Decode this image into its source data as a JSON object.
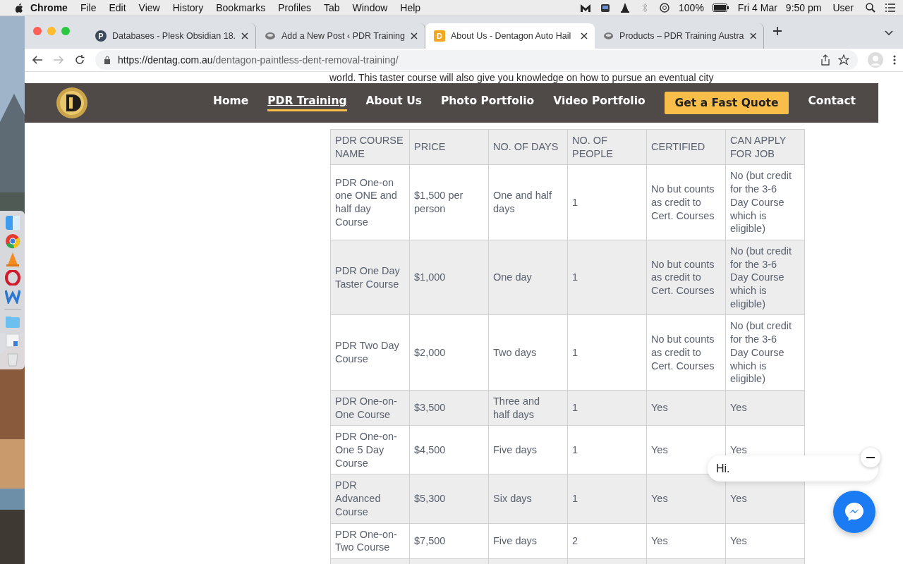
{
  "menu_bar": {
    "app": "Chrome",
    "items": [
      "File",
      "Edit",
      "View",
      "History",
      "Bookmarks",
      "Profiles",
      "Tab",
      "Window",
      "Help"
    ],
    "battery": "100%",
    "date": "Fri 4 Mar",
    "time": "9:50 pm",
    "user": "User"
  },
  "browser": {
    "tabs": [
      {
        "title": "Databases - Plesk Obsidian 18.",
        "kind": "letter",
        "icon_text": "P",
        "selected": false
      },
      {
        "title": "Add a New Post ‹ PDR Training",
        "kind": "site",
        "selected": false
      },
      {
        "title": "About Us - Dentagon Auto Hail",
        "kind": "brand",
        "icon_text": "D",
        "selected": true
      },
      {
        "title": "Products – PDR Training Austra",
        "kind": "site",
        "selected": false
      }
    ],
    "url_host": "https://dentag.com.au",
    "url_path": "/dentagon-paintless-dent-removal-training/"
  },
  "site": {
    "intro_fragment": "world. This taster course will also give you knowledge on how to pursue an eventual city",
    "nav": [
      {
        "label": "Home",
        "selected": false,
        "kind": "link"
      },
      {
        "label": "PDR Training",
        "selected": true,
        "kind": "link"
      },
      {
        "label": "About Us",
        "selected": false,
        "kind": "link"
      },
      {
        "label": "Photo Portfolio",
        "selected": false,
        "kind": "link"
      },
      {
        "label": "Video Portfolio",
        "selected": false,
        "kind": "link"
      },
      {
        "label": "Get a Fast Quote",
        "selected": false,
        "kind": "cta"
      },
      {
        "label": "Contact",
        "selected": false,
        "kind": "link"
      }
    ]
  },
  "table": {
    "columns": [
      "PDR COURSE NAME",
      "PRICE",
      "NO. OF DAYS",
      "NO. OF PEOPLE",
      "CERTIFIED",
      "CAN APPLY FOR JOB"
    ],
    "rows": [
      [
        "PDR One-on one ONE and half day Course",
        "$1,500 per person",
        "One and half days",
        "1",
        "No but counts as credit to Cert. Courses",
        "No (but credit for the 3-6 Day Course which is eligible)"
      ],
      [
        "PDR One Day Taster Course",
        "$1,000",
        "One day",
        "1",
        "No but counts as credit to Cert. Courses",
        "No (but credit for the 3-6 Day Course which is eligible)"
      ],
      [
        "PDR Two Day Course",
        "$2,000",
        "Two days",
        "1",
        "No but counts as credit to Cert. Courses",
        "No (but credit for the 3-6 Day Course which is eligible)"
      ],
      [
        "PDR One-on-One Course",
        "$3,500",
        "Three and half days",
        "1",
        "Yes",
        "Yes"
      ],
      [
        "PDR One-on-One 5 Day Course",
        "$4,500",
        "Five days",
        "1",
        "Yes",
        "Yes"
      ],
      [
        "PDR Advanced Course",
        "$5,300",
        "Six days",
        "1",
        "Yes",
        "Yes"
      ],
      [
        "PDR One-on-Two Course",
        "$7,500",
        "Five days",
        "2",
        "Yes",
        "Yes"
      ],
      [
        "",
        "",
        "",
        "",
        "",
        ""
      ]
    ]
  },
  "chat": {
    "greeting": "Hi."
  }
}
